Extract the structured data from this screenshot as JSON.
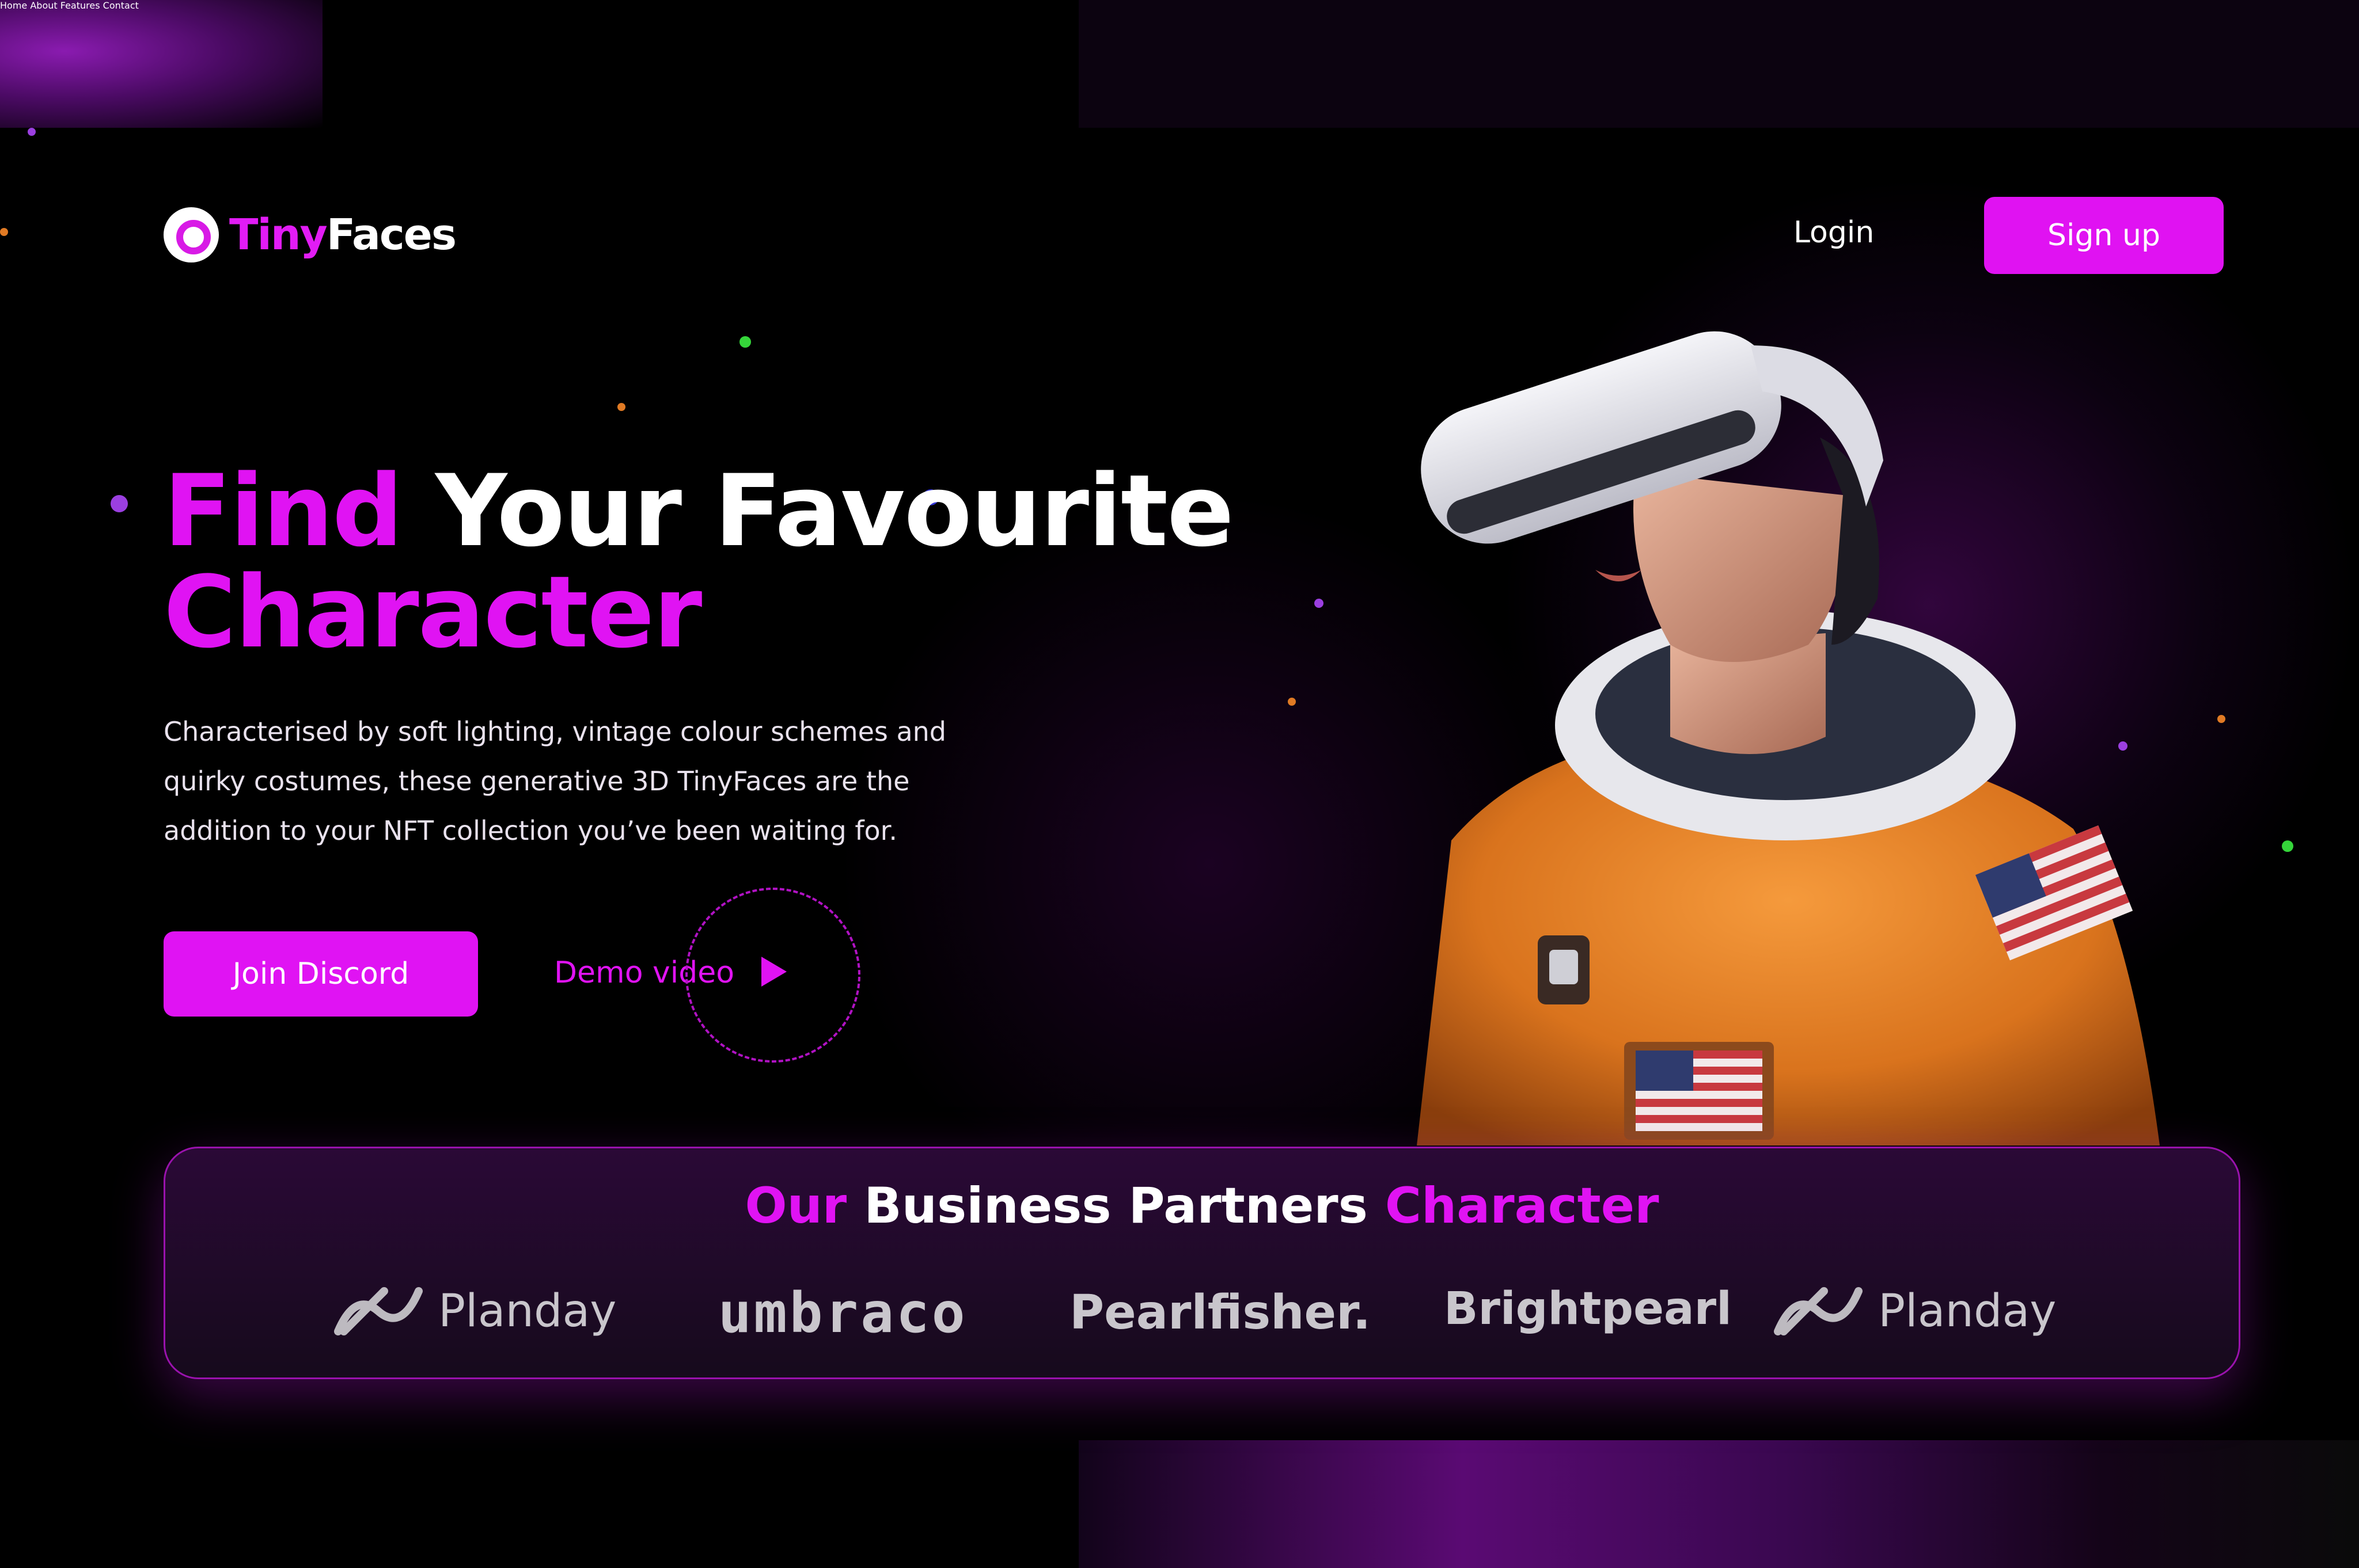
{
  "brand": {
    "logo_tiny": "Tiny",
    "logo_faces": "Faces",
    "logo_icon": "tinyfaces-logo-icon"
  },
  "nav": {
    "items": [
      "Home",
      "About",
      "Features",
      "Contact"
    ]
  },
  "auth": {
    "login_label": "Login",
    "signup_label": "Sign up"
  },
  "hero": {
    "title_find": "Find",
    "title_your_favourite": "Your Favourite",
    "title_character": "Character",
    "description": "Characterised by soft lighting, vintage colour schemes and quirky costumes, these generative 3D TinyFaces are the addition to your NFT collection you’ve been waiting for.",
    "join_label": "Join Discord",
    "demo_label": "Demo video",
    "play_icon": "play-icon"
  },
  "partners": {
    "title_our": "Our",
    "title_business": "Business Partners",
    "title_character": "Character",
    "logos": [
      "Planday",
      "umbraco",
      "Pearlfisher.",
      "Brightpearl",
      "Planday"
    ]
  },
  "colors": {
    "accent": "#e013f3",
    "background": "#000000",
    "text": "#ffffff"
  }
}
